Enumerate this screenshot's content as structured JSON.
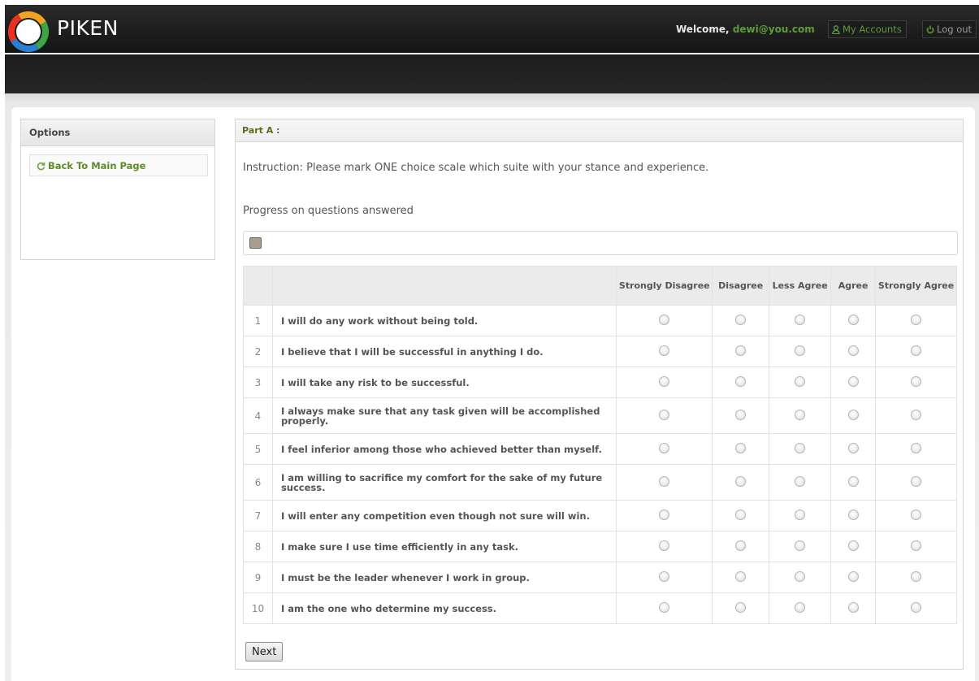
{
  "header": {
    "brand": "PIKEN",
    "welcome_prefix": "Welcome,",
    "user_email": "dewi@you.com",
    "my_accounts_label": "My Accounts",
    "logout_label": "Log out",
    "icons": {
      "accounts": "user-icon",
      "logout": "power-icon"
    }
  },
  "sidebar": {
    "title": "Options",
    "link_label": "Back To Main Page",
    "link_icon": "refresh-icon"
  },
  "main": {
    "part_title": "Part A :",
    "instruction": "Instruction: Please mark ONE choice scale which suite with your stance and experience.",
    "progress_label": "Progress on questions answered",
    "progress_fraction": 0.0,
    "columns": [
      "Strongly Disagree",
      "Disagree",
      "Less Agree",
      "Agree",
      "Strongly Agree"
    ],
    "questions": [
      {
        "num": "1",
        "text": "I will do any work without being told."
      },
      {
        "num": "2",
        "text": "I believe that I will be successful in anything I do."
      },
      {
        "num": "3",
        "text": "I will take any risk to be successful."
      },
      {
        "num": "4",
        "text": "I always make sure that any task given will be accomplished properly."
      },
      {
        "num": "5",
        "text": "I feel inferior among those who achieved better than myself."
      },
      {
        "num": "6",
        "text": "I am willing to sacrifice my comfort for the sake of my future success."
      },
      {
        "num": "7",
        "text": "I will enter any competition even though not sure will win."
      },
      {
        "num": "8",
        "text": "I make sure I use time efficiently in any task."
      },
      {
        "num": "9",
        "text": "I must be the leader whenever I work in group."
      },
      {
        "num": "10",
        "text": "I am the one who determine my success."
      }
    ],
    "next_label": "Next"
  },
  "colors": {
    "accent_green": "#5d9b3c",
    "header_dark": "#1c1c1c",
    "part_title": "#5a6d1c",
    "progress_fill": "#a69f8f"
  }
}
